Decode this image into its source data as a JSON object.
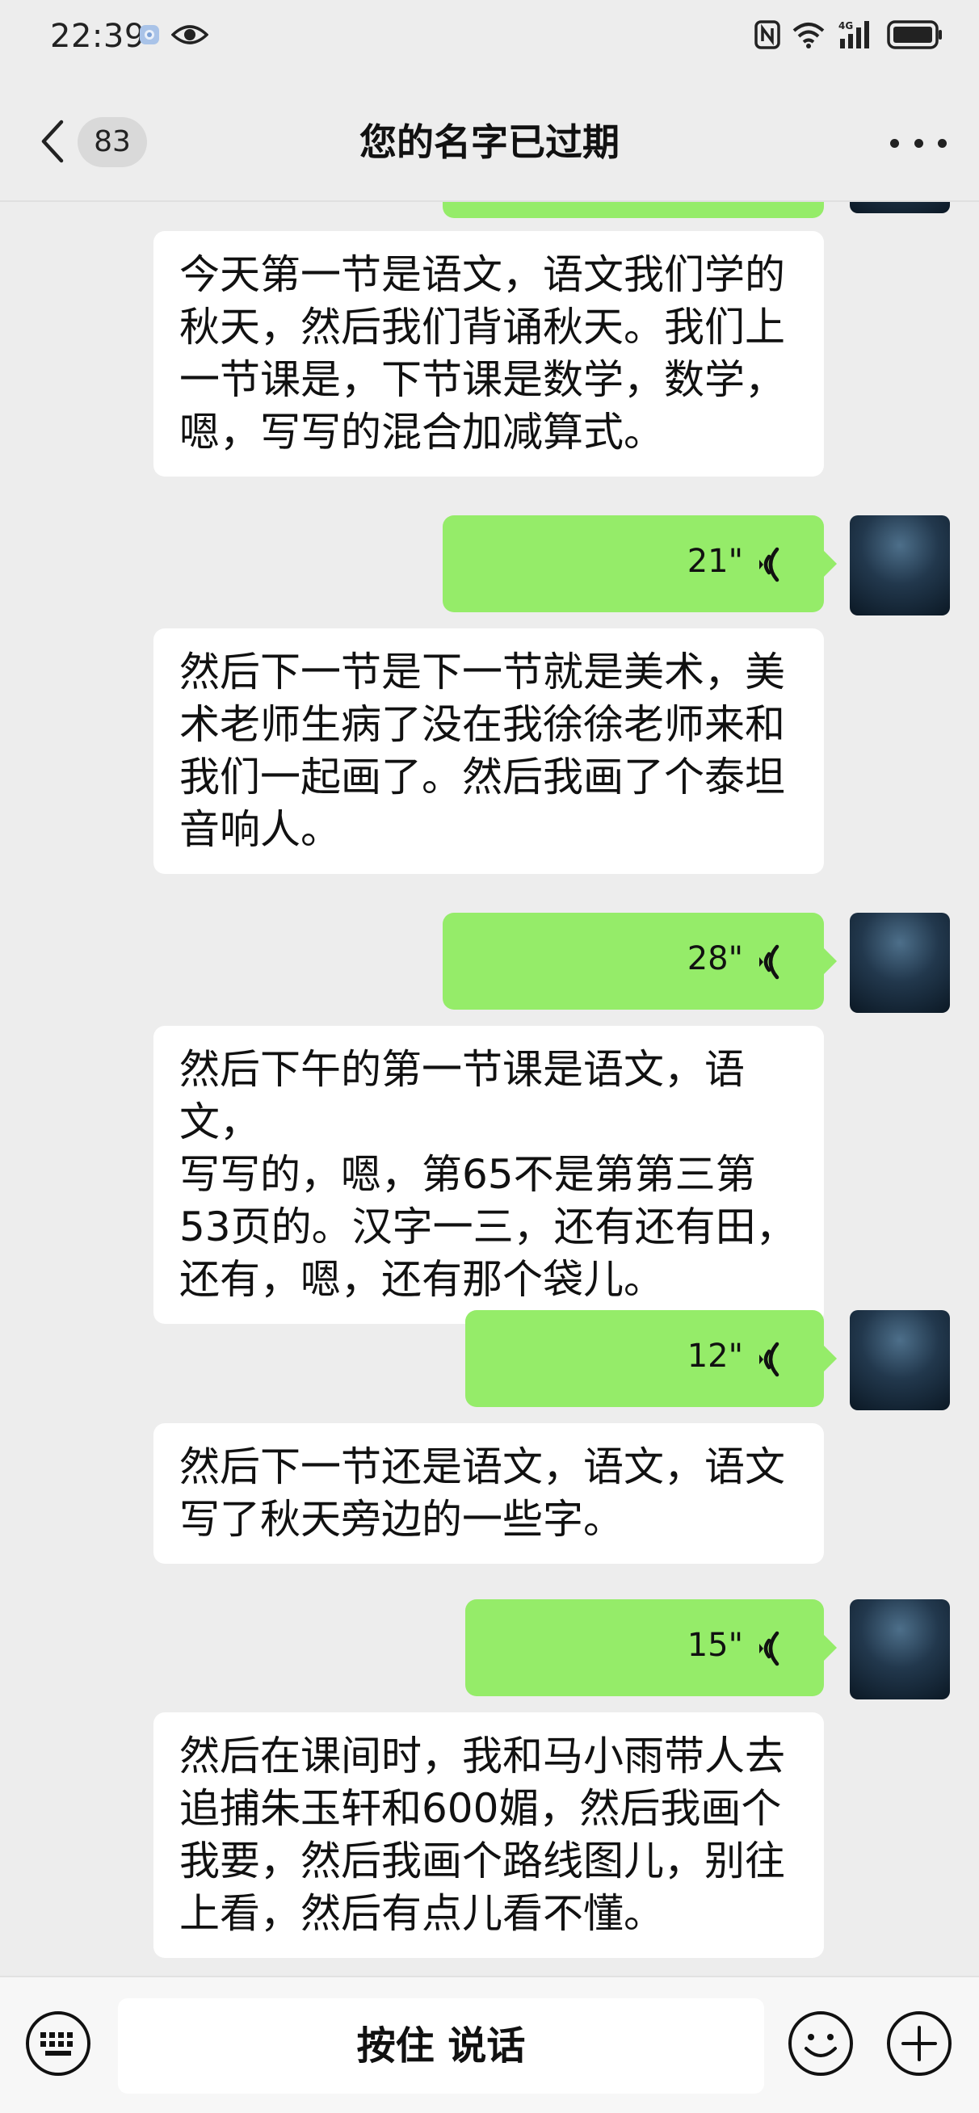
{
  "status_bar": {
    "time": "22:39",
    "icons_left": [
      "app-notification-icon",
      "eye-icon"
    ],
    "icons_right": [
      "nfc-icon",
      "wifi-icon",
      "4g-signal-icon",
      "battery-icon"
    ],
    "network_label": "4G"
  },
  "header": {
    "unread_count": "83",
    "title": "您的名字已过期",
    "icons": [
      "back-arrow-icon",
      "more-icon"
    ]
  },
  "messages": [
    {
      "type": "text",
      "side": "left",
      "text": "今天第一节是语文，语文我们学的\n秋天，然后我们背诵秋天。我们上\n一节课是，下节课是数学，数学，\n嗯，写写的混合加减算式。"
    },
    {
      "type": "voice",
      "side": "right",
      "duration": "21\""
    },
    {
      "type": "text",
      "side": "left",
      "text": "然后下一节是下一节就是美术，美\n术老师生病了没在我徐徐老师来和\n我们一起画了。然后我画了个泰坦\n音响人。"
    },
    {
      "type": "voice",
      "side": "right",
      "duration": "28\""
    },
    {
      "type": "text",
      "side": "left",
      "text": "然后下午的第一节课是语文，语文，\n写写的，嗯，第65不是第第三第\n53页的。汉字一三，还有还有田，\n还有，嗯，还有那个袋儿。"
    },
    {
      "type": "voice",
      "side": "right",
      "duration": "12\""
    },
    {
      "type": "text",
      "side": "left",
      "text": "然后下一节还是语文，语文，语文\n写了秋天旁边的一些字。"
    },
    {
      "type": "voice",
      "side": "right",
      "duration": "15\""
    },
    {
      "type": "text",
      "side": "left",
      "text": "然后在课间时，我和马小雨带人去\n追捕朱玉轩和600媚，然后我画个\n我要，然后我画个路线图儿，别往\n上看，然后有点儿看不懂。"
    }
  ],
  "input_bar": {
    "hold_to_talk_label": "按住 说话",
    "icons": [
      "keyboard-icon",
      "emoji-icon",
      "plus-icon"
    ]
  },
  "colors": {
    "background": "#ededed",
    "voice_bubble": "#95ec69",
    "text_bubble": "#ffffff"
  }
}
